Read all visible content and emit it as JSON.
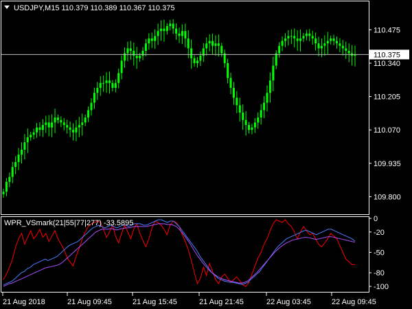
{
  "colors": {
    "background": "#000000",
    "frame": "#ffffff",
    "candles": "#00ff00",
    "price_line": "#c0c0c0",
    "wpr_red": "#ff0000",
    "wpr_blue": "#4a7dff",
    "wpr_violet": "#b050ff"
  },
  "main_pane": {
    "title": "USDJPY,M15  110.379 110.389 110.367 110.375"
  },
  "indicator_pane": {
    "title": "WPR_VSmark(21|55|77|277) -33.5895"
  },
  "chart_data": [
    {
      "type": "candlestick",
      "symbol": "USDJPY",
      "timeframe": "M15",
      "title": "USDJPY,M15  110.379 110.389 110.367 110.375",
      "ohlc_last": {
        "open": 110.379,
        "high": 110.389,
        "low": 110.367,
        "close": 110.375
      },
      "y_ticks": [
        110.475,
        110.34,
        110.205,
        110.07,
        109.935,
        109.8
      ],
      "current_price": 110.375,
      "ylim": [
        109.74,
        110.54
      ],
      "close": [
        109.82,
        109.86,
        109.88,
        109.92,
        109.94,
        109.97,
        109.99,
        110.02,
        110.04,
        110.05,
        110.06,
        110.08,
        110.07,
        110.09,
        110.1,
        110.08,
        110.1,
        110.12,
        110.11,
        110.1,
        110.09,
        110.08,
        110.07,
        110.06,
        110.08,
        110.09,
        110.1,
        110.12,
        110.15,
        110.18,
        110.22,
        110.24,
        110.26,
        110.26,
        110.27,
        110.26,
        110.24,
        110.26,
        110.3,
        110.35,
        110.38,
        110.4,
        110.39,
        110.37,
        110.36,
        110.37,
        110.39,
        110.42,
        110.44,
        110.43,
        110.45,
        110.47,
        110.48,
        110.47,
        110.49,
        110.5,
        110.48,
        110.46,
        110.45,
        110.47,
        110.44,
        110.4,
        110.36,
        110.34,
        110.35,
        110.37,
        110.4,
        110.42,
        110.43,
        110.41,
        110.42,
        110.41,
        110.38,
        110.34,
        110.28,
        110.24,
        110.2,
        110.17,
        110.14,
        110.11,
        110.09,
        110.07,
        110.08,
        110.1,
        110.12,
        110.15,
        110.18,
        110.22,
        110.27,
        110.33,
        110.38,
        110.41,
        110.43,
        110.44,
        110.45,
        110.45,
        110.44,
        110.43,
        110.44,
        110.45,
        110.46,
        110.45,
        110.44,
        110.42,
        110.4,
        110.41,
        110.42,
        110.43,
        110.44,
        110.43,
        110.42,
        110.41,
        110.4,
        110.39,
        110.38,
        110.37,
        110.375
      ],
      "x_ticks": [
        "21 Aug 2018",
        "21 Aug 09:45",
        "21 Aug 15:45",
        "21 Aug 21:45",
        "22 Aug 03:45",
        "22 Aug 09:45"
      ]
    },
    {
      "type": "line",
      "title": "WPR_VSmark(21|55|77|277) -33.5895",
      "y_ticks": [
        0,
        -20,
        -50,
        -80,
        -100
      ],
      "ylim": [
        -105,
        0
      ],
      "series": [
        {
          "color": "#ff0000",
          "values": [
            -90,
            -82,
            -72,
            -60,
            -42,
            -30,
            -22,
            -38,
            -28,
            -18,
            -30,
            -24,
            -16,
            -28,
            -22,
            -34,
            -26,
            -18,
            -30,
            -38,
            -46,
            -58,
            -64,
            -70,
            -56,
            -44,
            -30,
            -20,
            -12,
            -8,
            -6,
            -4,
            -6,
            -16,
            -28,
            -20,
            -10,
            -26,
            -36,
            -22,
            -10,
            -20,
            -30,
            -16,
            -8,
            -22,
            -32,
            -42,
            -30,
            -14,
            -4,
            -6,
            -10,
            -16,
            -24,
            -10,
            -4,
            -6,
            -12,
            -24,
            -34,
            -46,
            -62,
            -80,
            -96,
            -88,
            -72,
            -84,
            -66,
            -78,
            -90,
            -96,
            -86,
            -82,
            -88,
            -94,
            -90,
            -86,
            -92,
            -98,
            -100,
            -94,
            -82,
            -70,
            -58,
            -50,
            -38,
            -30,
            -18,
            -8,
            -2,
            -4,
            -6,
            -2,
            -8,
            -12,
            -20,
            -30,
            -20,
            -12,
            -18,
            -24,
            -22,
            -30,
            -38,
            -42,
            -36,
            -30,
            -22,
            -26,
            -30,
            -40,
            -50,
            -60,
            -64,
            -68,
            -68
          ]
        },
        {
          "color": "#4a7dff",
          "values": [
            -98,
            -96,
            -94,
            -92,
            -88,
            -84,
            -80,
            -78,
            -74,
            -72,
            -68,
            -66,
            -64,
            -62,
            -60,
            -62,
            -60,
            -58,
            -56,
            -52,
            -48,
            -44,
            -40,
            -38,
            -36,
            -34,
            -30,
            -26,
            -22,
            -18,
            -14,
            -12,
            -10,
            -12,
            -14,
            -12,
            -10,
            -12,
            -14,
            -12,
            -10,
            -10,
            -12,
            -10,
            -8,
            -8,
            -8,
            -10,
            -10,
            -8,
            -6,
            -4,
            -2,
            -2,
            -4,
            -6,
            -4,
            -4,
            -8,
            -12,
            -18,
            -24,
            -30,
            -36,
            -42,
            -48,
            -56,
            -62,
            -68,
            -74,
            -80,
            -84,
            -88,
            -90,
            -92,
            -93,
            -94,
            -94,
            -95,
            -96,
            -97,
            -96,
            -94,
            -90,
            -86,
            -82,
            -78,
            -72,
            -66,
            -60,
            -54,
            -48,
            -42,
            -38,
            -34,
            -30,
            -28,
            -26,
            -24,
            -22,
            -20,
            -18,
            -18,
            -20,
            -22,
            -24,
            -22,
            -20,
            -18,
            -16,
            -16,
            -18,
            -20,
            -22,
            -24,
            -26,
            -28,
            -30,
            -33.6
          ]
        },
        {
          "color": "#b050ff",
          "values": [
            -100,
            -98,
            -96,
            -95,
            -93,
            -91,
            -89,
            -87,
            -85,
            -83,
            -81,
            -79,
            -77,
            -75,
            -73,
            -72,
            -71,
            -70,
            -69,
            -67,
            -64,
            -60,
            -56,
            -52,
            -48,
            -44,
            -40,
            -36,
            -32,
            -28,
            -24,
            -20,
            -18,
            -16,
            -16,
            -16,
            -15,
            -16,
            -17,
            -16,
            -15,
            -14,
            -14,
            -13,
            -12,
            -12,
            -12,
            -12,
            -12,
            -11,
            -10,
            -9,
            -8,
            -8,
            -8,
            -9,
            -9,
            -10,
            -12,
            -16,
            -21,
            -27,
            -33,
            -40,
            -47,
            -54,
            -60,
            -66,
            -71,
            -76,
            -80,
            -83,
            -86,
            -88,
            -90,
            -91,
            -92,
            -93,
            -94,
            -95,
            -95,
            -94,
            -92,
            -88,
            -84,
            -80,
            -75,
            -70,
            -65,
            -60,
            -55,
            -50,
            -46,
            -42,
            -39,
            -36,
            -34,
            -32,
            -31,
            -30,
            -29,
            -28,
            -28,
            -29,
            -30,
            -31,
            -30,
            -29,
            -28,
            -27,
            -27,
            -28,
            -29,
            -30,
            -31,
            -32,
            -33,
            -34,
            -35
          ]
        }
      ]
    }
  ]
}
